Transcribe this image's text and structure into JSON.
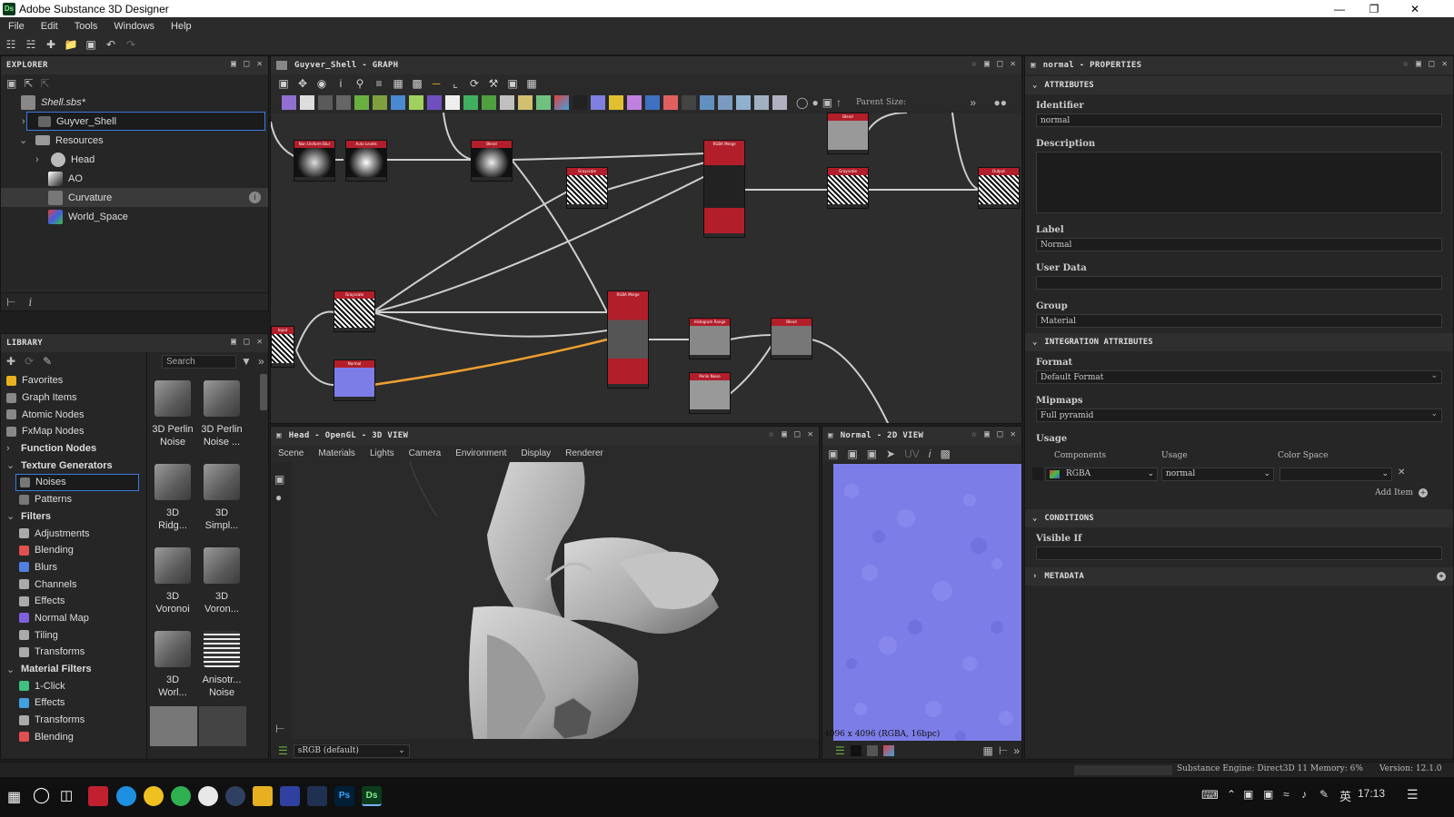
{
  "window": {
    "title": "Adobe Substance 3D Designer",
    "logo_text": "Ds",
    "minimize_icon": "minimize-icon",
    "maximize_icon": "restore-icon",
    "close_icon": "close-icon"
  },
  "menu": [
    "File",
    "Edit",
    "Tools",
    "Windows",
    "Help"
  ],
  "explorer": {
    "title": "EXPLORER",
    "package": "Shell.sbs*",
    "graph": "Guyver_Shell",
    "resources_label": "Resources",
    "items": [
      {
        "label": "Head",
        "icon": "mesh-icon"
      },
      {
        "label": "AO",
        "icon": "bitmap-icon"
      },
      {
        "label": "Curvature",
        "icon": "bitmap-icon"
      },
      {
        "label": "World_Space",
        "icon": "bitmap-icon"
      }
    ]
  },
  "library": {
    "title": "LIBRARY",
    "search_placeholder": "Search",
    "categories": [
      {
        "label": "Favorites",
        "color": "#e8b020",
        "bold": false
      },
      {
        "label": "Graph Items",
        "color": "#888888",
        "bold": false
      },
      {
        "label": "Atomic Nodes",
        "color": "#888888",
        "bold": false
      },
      {
        "label": "FxMap Nodes",
        "color": "#888888",
        "bold": false
      },
      {
        "label": "Function Nodes",
        "color": "#888888",
        "bold": true
      },
      {
        "label": "Texture Generators",
        "color": "#888888",
        "bold": true
      },
      {
        "label": "Noises",
        "color": "#777777",
        "bold": false
      },
      {
        "label": "Patterns",
        "color": "#777777",
        "bold": false
      },
      {
        "label": "Filters",
        "color": "#888888",
        "bold": true
      },
      {
        "label": "Adjustments",
        "color": "#aaaaaa",
        "bold": false
      },
      {
        "label": "Blending",
        "color": "#e05050",
        "bold": false
      },
      {
        "label": "Blurs",
        "color": "#5080e0",
        "bold": false
      },
      {
        "label": "Channels",
        "color": "#aaaaaa",
        "bold": false
      },
      {
        "label": "Effects",
        "color": "#aaaaaa",
        "bold": false
      },
      {
        "label": "Normal Map",
        "color": "#8060e0",
        "bold": false
      },
      {
        "label": "Tiling",
        "color": "#aaaaaa",
        "bold": false
      },
      {
        "label": "Transforms",
        "color": "#aaaaaa",
        "bold": false
      },
      {
        "label": "Material Filters",
        "color": "#888888",
        "bold": true
      },
      {
        "label": "1-Click",
        "color": "#40c080",
        "bold": false
      },
      {
        "label": "Effects",
        "color": "#40a0e0",
        "bold": false
      },
      {
        "label": "Transforms",
        "color": "#aaaaaa",
        "bold": false
      },
      {
        "label": "Blending",
        "color": "#e05050",
        "bold": false
      }
    ],
    "thumbnails": [
      {
        "label1": "3D Perlin",
        "label2": "Noise"
      },
      {
        "label1": "3D Perlin",
        "label2": "Noise ..."
      },
      {
        "label1": "3D",
        "label2": "Ridg..."
      },
      {
        "label1": "3D",
        "label2": "Simpl..."
      },
      {
        "label1": "3D",
        "label2": "Voronoi"
      },
      {
        "label1": "3D",
        "label2": "Voron..."
      },
      {
        "label1": "3D",
        "label2": "Worl..."
      },
      {
        "label1": "Anisotr...",
        "label2": "Noise"
      }
    ]
  },
  "graph": {
    "title": "Guyver_Shell - GRAPH",
    "parent_size_label": "Parent Size:"
  },
  "view3d": {
    "title": "Head - OpenGL - 3D VIEW",
    "tabs": [
      "Scene",
      "Materials",
      "Lights",
      "Camera",
      "Environment",
      "Display",
      "Renderer"
    ],
    "colorspace": "sRGB (default)"
  },
  "view2d": {
    "title": "Normal - 2D VIEW",
    "info": "4096 x 4096 (RGBA, 16bpc)"
  },
  "properties": {
    "title": "normal - PROPERTIES",
    "attributes_header": "ATTRIBUTES",
    "identifier_label": "Identifier",
    "identifier_value": "normal",
    "description_label": "Description",
    "label_label": "Label",
    "label_value": "Normal",
    "userdata_label": "User Data",
    "group_label": "Group",
    "group_value": "Material",
    "integration_header": "INTEGRATION ATTRIBUTES",
    "format_label": "Format",
    "format_value": "Default Format",
    "mipmaps_label": "Mipmaps",
    "mipmaps_value": "Full pyramid",
    "usage_label": "Usage",
    "col_components": "Components",
    "col_usage": "Usage",
    "col_colorspace": "Color Space",
    "components_value": "RGBA",
    "usage_value": "normal",
    "add_item": "Add Item",
    "conditions_header": "CONDITIONS",
    "visible_if_label": "Visible If",
    "metadata_header": "METADATA"
  },
  "status": {
    "engine": "Substance Engine: Direct3D 11 Memory: 6%",
    "version": "Version: 12.1.0"
  },
  "taskbar": {
    "ime": "英",
    "time": "17:13"
  }
}
